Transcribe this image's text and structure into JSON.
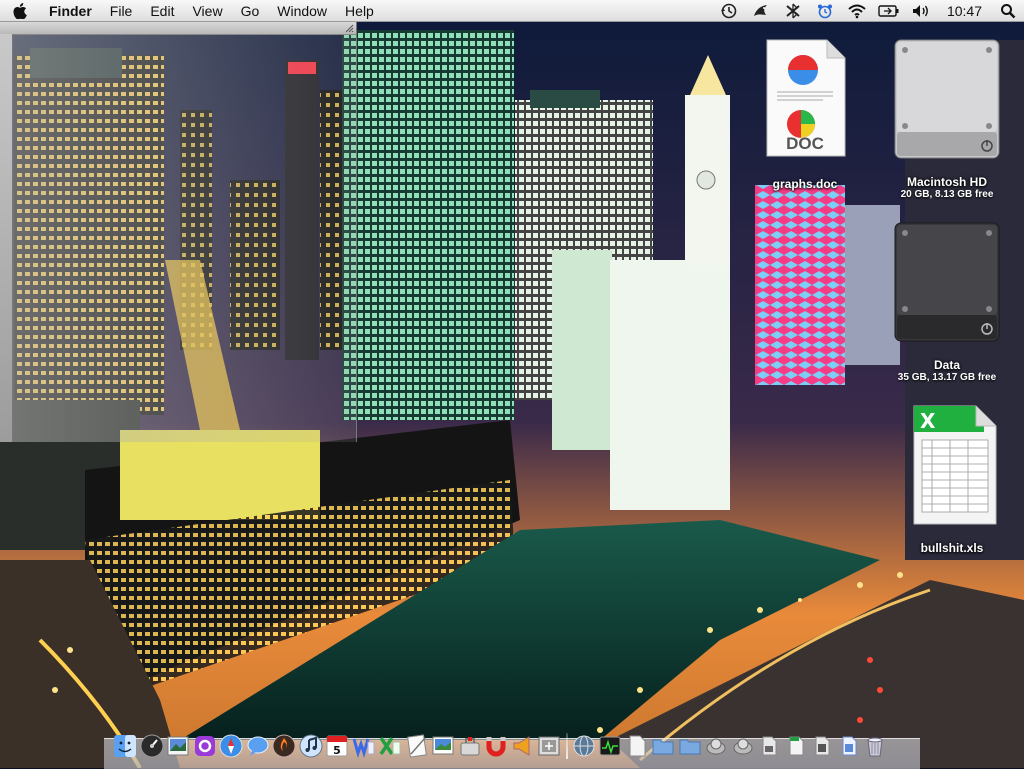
{
  "menubar": {
    "app_name": "Finder",
    "menus": [
      "File",
      "Edit",
      "View",
      "Go",
      "Window",
      "Help"
    ],
    "clock": "10:47",
    "status_icons": [
      "time-machine-icon",
      "growl-icon",
      "bluetooth-icon",
      "alarm-icon",
      "wifi-icon",
      "battery-icon",
      "volume-icon"
    ]
  },
  "desktop": {
    "icons": [
      {
        "name": "graphs.doc",
        "badge": "DOC",
        "kind": "word-document"
      },
      {
        "name": "Macintosh HD",
        "detail": "20 GB, 8.13 GB free",
        "kind": "hard-drive"
      },
      {
        "name": "Data",
        "detail": "35 GB, 13.17 GB free",
        "kind": "hard-drive"
      },
      {
        "name": "bullshit.xls",
        "kind": "excel-spreadsheet"
      }
    ]
  },
  "dock": {
    "apps": [
      "finder",
      "dashboard",
      "preview",
      "ichat-alt",
      "safari",
      "ichat",
      "mail-stamp",
      "itunes",
      "ical",
      "word",
      "excel",
      "textedit",
      "iphoto",
      "toolbox",
      "magnet",
      "megaphone",
      "screenshot"
    ],
    "ical_day": "5",
    "others": [
      "network-utility",
      "activity-monitor",
      "document",
      "folder",
      "folder",
      "stack-1",
      "stack-2",
      "file",
      "file-green",
      "file",
      "file-blue",
      "trash"
    ]
  },
  "colors": {
    "menubar": "#e8e8e8",
    "sky_top": "#0d1a3a",
    "sky_horizon": "#e98a3a",
    "river": "#0b3a35",
    "neon_pink": "#ff3d8a"
  }
}
